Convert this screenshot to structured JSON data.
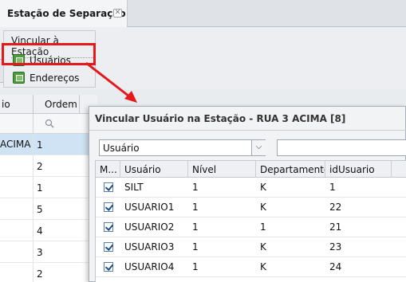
{
  "tab": {
    "title": "Estação de Separação",
    "close_label": "✕"
  },
  "menu": {
    "title": "Vincular à Estação",
    "items": [
      {
        "label": "Usuários",
        "icon": "link-icon"
      },
      {
        "label": "Endereços",
        "icon": "link-icon"
      }
    ]
  },
  "grid": {
    "headers": [
      "io",
      "Ordem"
    ],
    "rows": [
      {
        "col1": "ACIMA",
        "ordem": "1",
        "selected": true
      },
      {
        "col1": "",
        "ordem": "2"
      },
      {
        "col1": "",
        "ordem": "1"
      },
      {
        "col1": "",
        "ordem": "5"
      },
      {
        "col1": "",
        "ordem": "4"
      },
      {
        "col1": "",
        "ordem": "3"
      },
      {
        "col1": "",
        "ordem": "2"
      }
    ]
  },
  "dialog": {
    "title": "Vincular Usuário na Estação - RUA 3 ACIMA [8]",
    "filter_field": "Usuário",
    "search_value": "",
    "columns": [
      "M...",
      "Usuário",
      "Nível",
      "Departamento",
      "idUsuario"
    ],
    "rows": [
      {
        "usuario": "SILT",
        "nivel": "1",
        "departamento": "K",
        "id": "1"
      },
      {
        "usuario": "USUARIO1",
        "nivel": "1",
        "departamento": "K",
        "id": "22"
      },
      {
        "usuario": "USUARIO2",
        "nivel": "1",
        "departamento": "1",
        "id": "21"
      },
      {
        "usuario": "USUARIO3",
        "nivel": "1",
        "departamento": "K",
        "id": "23"
      },
      {
        "usuario": "USUARIO4",
        "nivel": "1",
        "departamento": "K",
        "id": "24"
      }
    ]
  },
  "colors": {
    "highlight": "#e5191c",
    "selected_row": "#cfe3f5"
  }
}
